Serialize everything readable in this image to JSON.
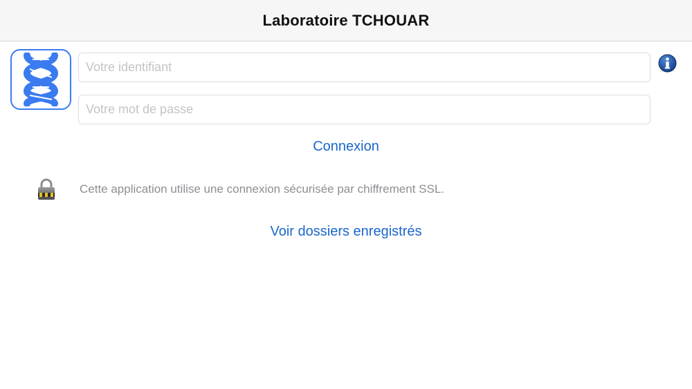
{
  "navbar": {
    "title": "Laboratoire TCHOUAR"
  },
  "login": {
    "username_placeholder": "Votre identifiant",
    "username_value": "",
    "password_placeholder": "Votre mot de passe",
    "password_value": "",
    "connect_label": "Connexion"
  },
  "security": {
    "message": "Cette application utilise une connexion sécurisée par chiffrement SSL."
  },
  "saved": {
    "label": "Voir dossiers enregistrés"
  },
  "icons": {
    "logo": "dna-helix-logo",
    "info": "info-icon",
    "lock": "padlock-icon"
  },
  "colors": {
    "accent": "#1a66cc",
    "logo_blue": "#3a7bef",
    "info_blue": "#1c55a8",
    "navbar_bg": "#f6f6f7",
    "muted_text": "#8e8e93"
  }
}
